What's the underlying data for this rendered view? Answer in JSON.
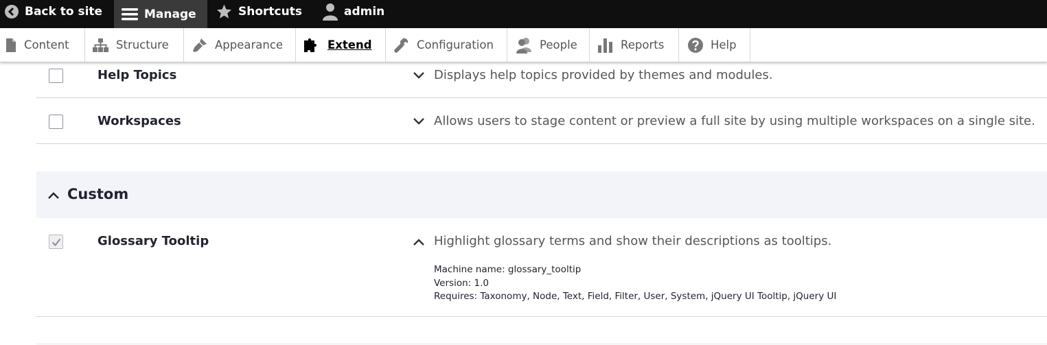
{
  "toolbar": {
    "back_label": "Back to site",
    "manage_label": "Manage",
    "shortcuts_label": "Shortcuts",
    "user_label": "admin"
  },
  "tray": {
    "items": [
      {
        "label": "Content",
        "icon": "file-icon"
      },
      {
        "label": "Structure",
        "icon": "sitemap-icon"
      },
      {
        "label": "Appearance",
        "icon": "paintbrush-icon"
      },
      {
        "label": "Extend",
        "icon": "puzzle-icon",
        "active": true
      },
      {
        "label": "Configuration",
        "icon": "wrench-icon"
      },
      {
        "label": "People",
        "icon": "people-icon"
      },
      {
        "label": "Reports",
        "icon": "bar-chart-icon"
      },
      {
        "label": "Help",
        "icon": "help-icon"
      }
    ]
  },
  "modules": {
    "help_topics": {
      "name": "Help Topics",
      "description": "Displays help topics provided by themes and modules.",
      "checked": false
    },
    "workspaces": {
      "name": "Workspaces",
      "description": "Allows users to stage content or preview a full site by using multiple workspaces on a single site.",
      "checked": false
    }
  },
  "custom_group": {
    "title": "Custom",
    "module": {
      "name": "Glossary Tooltip",
      "description": "Highlight glossary terms and show their descriptions as tooltips.",
      "checked": true,
      "machine_name": "Machine name: glossary_tooltip",
      "version": "Version: 1.0",
      "requires": "Requires: Taxonomy, Node, Text, Field, Filter, User, System, jQuery UI Tooltip, jQuery UI"
    }
  },
  "colors": {
    "toolbar_bg": "#0f0f0f",
    "toolbar_active": "#3a3a3a",
    "group_header_bg": "#f3f4f9"
  }
}
